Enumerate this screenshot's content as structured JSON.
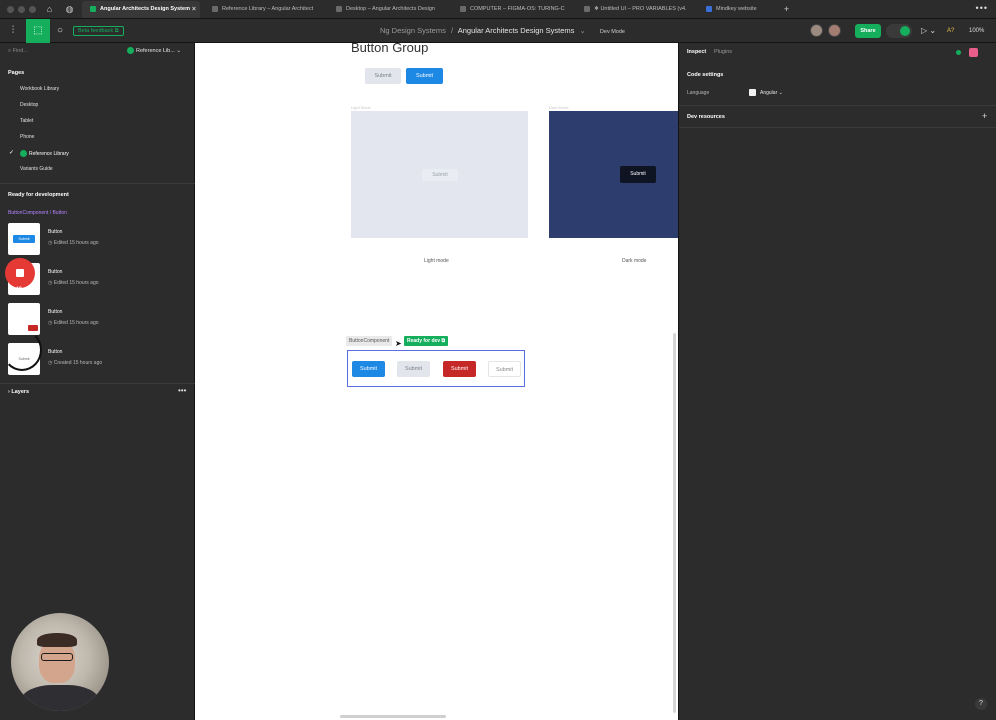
{
  "tabs": [
    {
      "label": "Angular Architects Design System",
      "active": true
    },
    {
      "label": "Reference Library – Angular Architect",
      "active": false
    },
    {
      "label": "Desktop – Angular Architects Design",
      "active": false
    },
    {
      "label": "COMPUTER – FIGMA-OS: TURING-C",
      "active": false
    },
    {
      "label": "❖ Untitled UI – PRO VARIABLES (v4.",
      "active": false
    },
    {
      "label": "Mindkey website",
      "active": false
    }
  ],
  "toolbar": {
    "beta_feedback": "Beta feedback ⧉",
    "breadcrumb_team": "Ng Design Systems",
    "breadcrumb_sep": "/",
    "breadcrumb_file": "Angular Architects Design Systems",
    "breadcrumb_caret": "⌄",
    "dev_mode": "Dev Mode",
    "share": "Share",
    "ai": "A?",
    "zoom": "100%"
  },
  "left_panel": {
    "find_placeholder": "Find...",
    "current_page_label": "Reference Lib...",
    "pages_title": "Pages",
    "pages": [
      "Workbook Library",
      "Desktop",
      "Tablet",
      "Phone",
      "Reference Library",
      "Variants Guide"
    ],
    "selected_page": "Reference Library",
    "ready_title": "Ready for development",
    "component_path": "ButtonComponent / Button",
    "components": [
      {
        "name": "Button",
        "meta": "Edited 15 hours ago",
        "thumb_label": "Submit",
        "thumb_style": "primary"
      },
      {
        "name": "Button",
        "meta": "Edited 15 hours ago",
        "thumb_label": "",
        "thumb_style": "none"
      },
      {
        "name": "Button",
        "meta": "Edited 15 hours ago",
        "thumb_label": "",
        "thumb_style": "none"
      },
      {
        "name": "Button",
        "meta": "Created 15 hours ago",
        "thumb_label": "Submit",
        "thumb_style": "plain"
      }
    ],
    "layers_title": "Layers",
    "recording_time": "4:40"
  },
  "canvas": {
    "section_title": "Button Group",
    "top_buttons": [
      "Submit",
      "Submit"
    ],
    "light_mode_label": "Light mode",
    "dark_mode_label": "Dark mode",
    "light_panel_button": "Submit",
    "dark_panel_button": "Submit",
    "frame_name": "ButtonComponent",
    "ready_badge": "Ready for dev ⧉",
    "variant_buttons": [
      "Submit",
      "Submit",
      "Submit",
      "Submit"
    ]
  },
  "right_panel": {
    "tabs": [
      "Inspect",
      "Plugins"
    ],
    "code_settings": "Code settings",
    "language_label": "Language",
    "language_value": "Angular",
    "dev_resources": "Dev resources",
    "add_symbol": "+",
    "help": "?"
  },
  "colors": {
    "accent_green": "#14ae5c",
    "primary_blue": "#1e88e5",
    "danger_red": "#c62828",
    "dark_panel": "#2c3d6e",
    "selection": "#5b6ee1",
    "component_purple": "#b585ff"
  }
}
